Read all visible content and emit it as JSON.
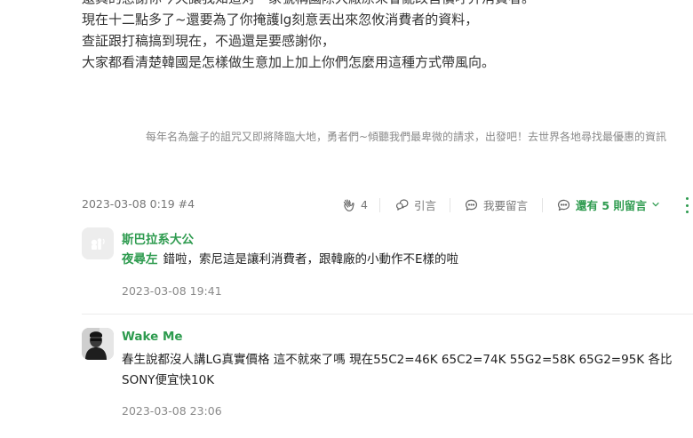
{
  "post": {
    "lines": [
      "還真的感謝你今天讓我知道对一家號稱國際大廠原來會亂改售價呼弄消費者。",
      "現在十二點多了~還要為了你掩護lg刻意丟出來忽攸消費者的資料，",
      "查証跟打稿搞到現在，不過還是要感謝你，",
      "大家都看清楚韓國是怎樣做生意加上加上你們怎麼用這種方式帶風向。"
    ],
    "signature": "每年名為盤子的詛咒又即將降臨大地，勇者們~傾聽我們最卑微的請求，出發吧！去世界各地尋找最優惠的資訊"
  },
  "meta": {
    "timestamp": "2023-03-08 0:19 #4",
    "like_count": "4",
    "quote_label": "引言",
    "reply_label": "我要留言",
    "more_replies_label": "還有 5 則留言"
  },
  "comments": [
    {
      "author": "斯巴拉系大公",
      "mention": "夜尋左",
      "text": "錯啦，索尼這是讓利消費者，跟韓廠的小動作不E樣的啦",
      "time": "2023-03-08 19:41"
    },
    {
      "author": "Wake Me",
      "text_line1": "春生說都沒人講LG真實價格 這不就來了嗎 現在55C2=46K 65C2=74K 55G2=58K 65G2=95K 各比",
      "text_line2": "SONY便宜快10K",
      "time": "2023-03-08 23:06"
    }
  ],
  "colors": {
    "accent": "#2e9b4f",
    "muted": "#777777"
  }
}
